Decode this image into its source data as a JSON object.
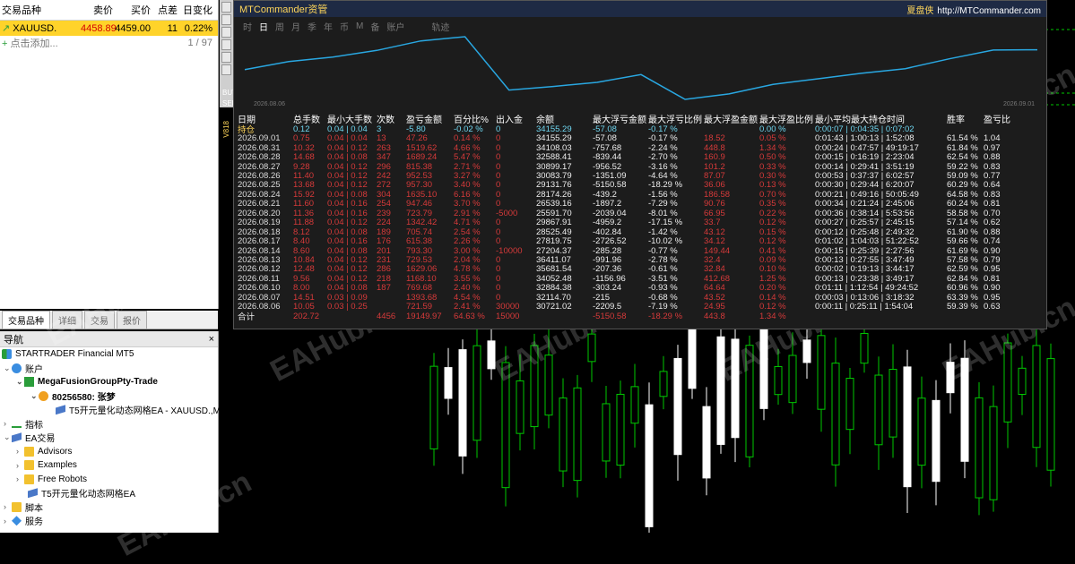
{
  "market_watch": {
    "headers": [
      "交易品种",
      "卖价",
      "买价",
      "点差",
      "日变化"
    ],
    "symbol": "XAUUSD.",
    "bid": "4458.89",
    "ask": "4459.00",
    "spread": "11",
    "change": "0.22%",
    "add_label": "点击添加...",
    "count": "1 / 97",
    "tabs": [
      "交易品种",
      "详细",
      "交易",
      "报价"
    ]
  },
  "navigator": {
    "title": "导航",
    "close": "×",
    "items": [
      {
        "label": "STARTRADER Financial MT5",
        "icon": "app-icon"
      },
      {
        "label": "账户",
        "icon": "account-icon"
      },
      {
        "label": "MegaFusionGroupPty-Trade",
        "icon": "server-icon"
      },
      {
        "label": "80256580: 张梦",
        "icon": "user-icon"
      },
      {
        "label": "T5开元量化动态网格EA - XAUUSD.,M",
        "icon": "ea-icon"
      },
      {
        "label": "指标",
        "icon": "indicator-icon"
      },
      {
        "label": "EA交易",
        "icon": "ea-icon"
      },
      {
        "label": "Advisors",
        "icon": "folder-icon"
      },
      {
        "label": "Examples",
        "icon": "folder-icon"
      },
      {
        "label": "Free Robots",
        "icon": "folder-icon"
      },
      {
        "label": "T5开元量化动态网格EA",
        "icon": "ea-icon"
      },
      {
        "label": "脚本",
        "icon": "folder-icon"
      },
      {
        "label": "服务",
        "icon": "service-icon"
      }
    ]
  },
  "chart": {
    "side_labels": [
      "BUY",
      "SELL",
      "V818"
    ],
    "watermark": "EAHub.cn"
  },
  "panel": {
    "title": "MTCommander资管",
    "brand": "夏盘侠",
    "url": "http://MTCommander.com",
    "tabs": [
      "时",
      "日",
      "周",
      "月",
      "季",
      "年",
      "币",
      "M",
      "备",
      "账户",
      "轨迹"
    ],
    "active_tab": "日",
    "curve_start_label": "2026.08.06",
    "curve_end_label": "2026.09.01",
    "headers": [
      "日期",
      "总手数",
      "最小大手数",
      "次数",
      "盈亏金额",
      "百分比%",
      "出入金",
      "余额",
      "最大浮亏金额",
      "最大浮亏比例",
      "最大浮盈金额",
      "最大浮盈比例",
      "最小平均最大持仓时间",
      "胜率",
      "盈亏比"
    ],
    "rows": [
      [
        "持仓",
        "0.12",
        "0.04 | 0.04",
        "3",
        "-5.80",
        "-0.02 %",
        "0",
        "34155.29",
        "-57.08",
        "-0.17 %",
        "",
        "0.00 %",
        "0:00:07 | 0:04:35 | 0:07:02",
        "",
        ""
      ],
      [
        "2026.09.01",
        "0.75",
        "0.04 | 0.04",
        "13",
        "47.26",
        "0.14 %",
        "0",
        "34155.29",
        "-57.08",
        "-0.17 %",
        "18.52",
        "0.05 %",
        "0:01:43 | 1:00:13 | 1:52:08",
        "61.54 %",
        "1.04"
      ],
      [
        "2026.08.31",
        "10.32",
        "0.04 | 0.12",
        "263",
        "1519.62",
        "4.66 %",
        "0",
        "34108.03",
        "-757.68",
        "-2.24 %",
        "448.8",
        "1.34 %",
        "0:00:24 | 0:47:57 | 49:19:17",
        "61.84 %",
        "0.97"
      ],
      [
        "2026.08.28",
        "14.68",
        "0.04 | 0.08",
        "347",
        "1689.24",
        "5.47 %",
        "0",
        "32588.41",
        "-839.44",
        "-2.70 %",
        "160.9",
        "0.50 %",
        "0:00:15 | 0:16:19 | 2:23:04",
        "62.54 %",
        "0.88"
      ],
      [
        "2026.08.27",
        "9.28",
        "0.04 | 0.12",
        "296",
        "815.38",
        "2.71 %",
        "0",
        "30899.17",
        "-956.52",
        "-3.16 %",
        "101.2",
        "0.33 %",
        "0:00:14 | 0:29:41 | 3:51:19",
        "59.22 %",
        "0.83"
      ],
      [
        "2026.08.26",
        "11.40",
        "0.04 | 0.12",
        "242",
        "952.53",
        "3.27 %",
        "0",
        "30083.79",
        "-1351.09",
        "-4.64 %",
        "87.07",
        "0.30 %",
        "0:00:53 | 0:37:37 | 6:02:57",
        "59.09 %",
        "0.77"
      ],
      [
        "2026.08.25",
        "13.68",
        "0.04 | 0.12",
        "272",
        "957.30",
        "3.40 %",
        "0",
        "29131.76",
        "-5150.58",
        "-18.29 %",
        "36.06",
        "0.13 %",
        "0:00:30 | 0:29:44 | 6:20:07",
        "60.29 %",
        "0.64"
      ],
      [
        "2026.08.24",
        "15.92",
        "0.04 | 0.08",
        "304",
        "1635.10",
        "6.16 %",
        "0",
        "28174.26",
        "-439.2",
        "-1.56 %",
        "186.58",
        "0.70 %",
        "0:00:21 | 0:49:16 | 50:05:49",
        "64.58 %",
        "0.83"
      ],
      [
        "2026.08.21",
        "11.60",
        "0.04 | 0.16",
        "254",
        "947.46",
        "3.70 %",
        "0",
        "26539.16",
        "-1897.2",
        "-7.29 %",
        "90.76",
        "0.35 %",
        "0:00:34 | 0:21:24 | 2:45:06",
        "60.24 %",
        "0.81"
      ],
      [
        "2026.08.20",
        "11.36",
        "0.04 | 0.16",
        "239",
        "723.79",
        "2.91 %",
        "-5000",
        "25591.70",
        "-2039.04",
        "-8.01 %",
        "66.95",
        "0.22 %",
        "0:00:36 | 0:38:14 | 5:53:56",
        "58.58 %",
        "0.70"
      ],
      [
        "2026.08.19",
        "11.88",
        "0.04 | 0.12",
        "224",
        "1342.42",
        "4.71 %",
        "0",
        "29867.91",
        "-4959.2",
        "-17.15 %",
        "33.7",
        "0.12 %",
        "0:00:27 | 0:25:57 | 2:45:15",
        "57.14 %",
        "0.62"
      ],
      [
        "2026.08.18",
        "8.12",
        "0.04 | 0.08",
        "189",
        "705.74",
        "2.54 %",
        "0",
        "28525.49",
        "-402.84",
        "-1.42 %",
        "43.12",
        "0.15 %",
        "0:00:12 | 0:25:48 | 2:49:32",
        "61.90 %",
        "0.88"
      ],
      [
        "2026.08.17",
        "8.40",
        "0.04 | 0.16",
        "176",
        "615.38",
        "2.26 %",
        "0",
        "27819.75",
        "-2726.52",
        "-10.02 %",
        "34.12",
        "0.12 %",
        "0:01:02 | 1:04:03 | 51:22:52",
        "59.66 %",
        "0.74"
      ],
      [
        "2026.08.14",
        "8.60",
        "0.04 | 0.08",
        "201",
        "793.30",
        "3.00 %",
        "-10000",
        "27204.37",
        "-285.28",
        "-0.77 %",
        "149.44",
        "0.41 %",
        "0:00:15 | 0:25:39 | 2:27:56",
        "61.69 %",
        "0.90"
      ],
      [
        "2026.08.13",
        "10.84",
        "0.04 | 0.12",
        "231",
        "729.53",
        "2.04 %",
        "0",
        "36411.07",
        "-991.96",
        "-2.78 %",
        "32.4",
        "0.09 %",
        "0:00:13 | 0:27:55 | 3:47:49",
        "57.58 %",
        "0.79"
      ],
      [
        "2026.08.12",
        "12.48",
        "0.04 | 0.12",
        "286",
        "1629.06",
        "4.78 %",
        "0",
        "35681.54",
        "-207.36",
        "-0.61 %",
        "32.84",
        "0.10 %",
        "0:00:02 | 0:19:13 | 3:44:17",
        "62.59 %",
        "0.95"
      ],
      [
        "2026.08.11",
        "9.56",
        "0.04 | 0.12",
        "218",
        "1168.10",
        "3.55 %",
        "0",
        "34052.48",
        "-1156.96",
        "-3.51 %",
        "412.68",
        "1.25 %",
        "0:00:13 | 0:23:38 | 3:49:17",
        "62.84 %",
        "0.81"
      ],
      [
        "2026.08.10",
        "8.00",
        "0.04 | 0.08",
        "187",
        "769.68",
        "2.40 %",
        "0",
        "32884.38",
        "-303.24",
        "-0.93 %",
        "64.64",
        "0.20 %",
        "0:01:11 | 1:12:54 | 49:24:52",
        "60.96 %",
        "0.90"
      ],
      [
        "2026.08.07",
        "14.51",
        "0.03 | 0.09",
        "",
        "1393.68",
        "4.54 %",
        "0",
        "32114.70",
        "-215",
        "-0.68 %",
        "43.52",
        "0.14 %",
        "0:00:03 | 0:13:06 | 3:18:32",
        "63.39 %",
        "0.95"
      ],
      [
        "2026.08.06",
        "10.05",
        "0.03 | 0.25",
        "",
        "721.59",
        "2.41 %",
        "30000",
        "30721.02",
        "-2209.5",
        "-7.19 %",
        "24.95",
        "0.12 %",
        "0:00:11 | 0:25:11 | 1:54:04",
        "59.39 %",
        "0.63"
      ]
    ],
    "total": [
      "合计",
      "202.72",
      "",
      "4456",
      "19149.97",
      "64.63 %",
      "15000",
      "",
      "-5150.58",
      "-18.29 %",
      "443.8",
      "1.34 %",
      "",
      "",
      ""
    ]
  },
  "colors": {
    "selected_row": "#ffd32a",
    "panel_bg": "#1c1c1c",
    "curve": "#29a7e1",
    "negative": "#d63a3a",
    "candle_bull": "#ffffff",
    "candle_bear": "#00c800"
  }
}
